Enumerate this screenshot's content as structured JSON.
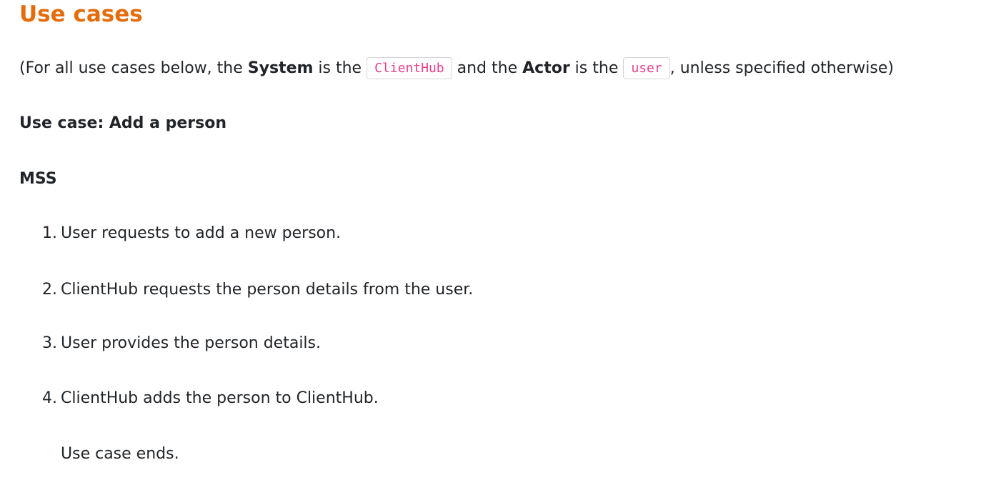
{
  "heading": "Use cases",
  "intro": {
    "prefix": "(For all use cases below, the ",
    "system_label": "System",
    "is_the_1": " is the ",
    "system_value": "ClientHub",
    "and_the": " and the ",
    "actor_label": "Actor",
    "is_the_2": " is the ",
    "actor_value": "user",
    "suffix": ", unless specified otherwise)"
  },
  "use_case_title": "Use case: Add a person",
  "mss_label": "MSS",
  "steps": [
    {
      "number": "1.",
      "text": "User requests to add a new person."
    },
    {
      "number": "2.",
      "text": "ClientHub requests the person details from the user."
    },
    {
      "number": "3.",
      "text": "User provides the person details."
    },
    {
      "number": "4.",
      "text": "ClientHub adds the person to ClientHub."
    }
  ],
  "ending": "Use case ends.",
  "colors": {
    "heading": "#e46c0a",
    "code_text": "#e83e8c",
    "body_text": "#212529"
  }
}
